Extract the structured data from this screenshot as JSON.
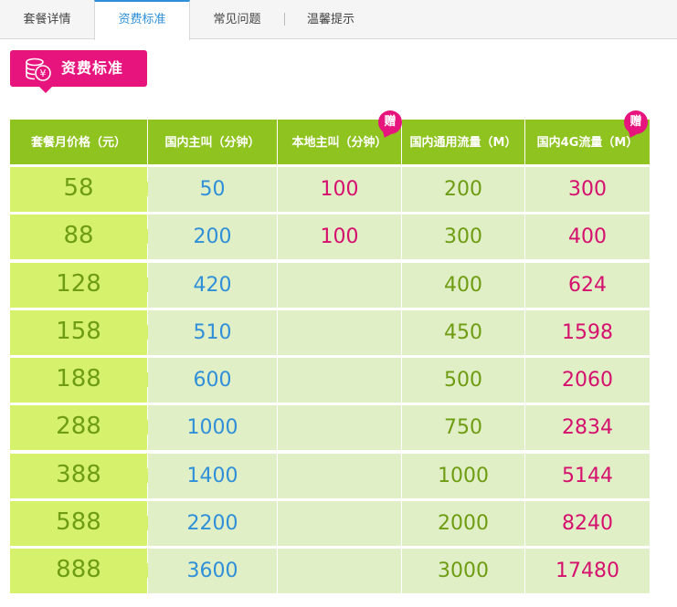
{
  "tabs": [
    {
      "label": "套餐详情",
      "active": false
    },
    {
      "label": "资费标准",
      "active": true
    },
    {
      "label": "常见问题",
      "active": false
    },
    {
      "label": "温馨提示",
      "active": false
    }
  ],
  "section": {
    "title": "资费标准",
    "icon": "coin-stack-icon"
  },
  "table": {
    "headers": [
      "套餐月价格（元）",
      "国内主叫（分钟）",
      "本地主叫（分钟）",
      "国内通用流量（M）",
      "国内4G流量（M）"
    ],
    "gift_label": "赠",
    "rows": [
      [
        "58",
        "50",
        "100",
        "200",
        "300"
      ],
      [
        "88",
        "200",
        "100",
        "300",
        "400"
      ],
      [
        "128",
        "420",
        "",
        "400",
        "624"
      ],
      [
        "158",
        "510",
        "",
        "450",
        "1598"
      ],
      [
        "188",
        "600",
        "",
        "500",
        "2060"
      ],
      [
        "288",
        "1000",
        "",
        "750",
        "2834"
      ],
      [
        "388",
        "1400",
        "",
        "1000",
        "5144"
      ],
      [
        "588",
        "2200",
        "",
        "2000",
        "8240"
      ],
      [
        "888",
        "3600",
        "",
        "3000",
        "17480"
      ]
    ]
  },
  "colors": {
    "accent": "#e8147e",
    "header_green": "#8fc31f",
    "price_cell": "#d6f26c",
    "cell_bg": "#e1efc6",
    "blue_text": "#2f8fd8",
    "green_text": "#6e9c12",
    "pink_text": "#d5106e"
  }
}
